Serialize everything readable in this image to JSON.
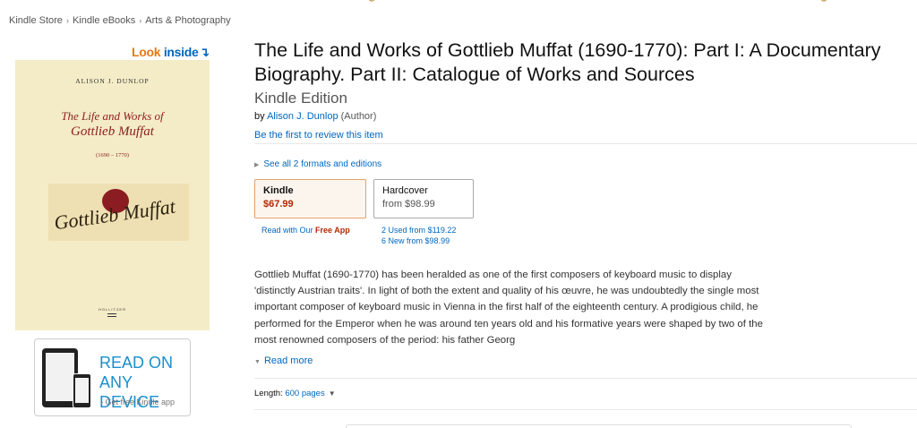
{
  "breadcrumb": [
    "Kindle Store",
    "Kindle eBooks",
    "Arts & Photography"
  ],
  "look_inside": {
    "word1": "Look",
    "word2": "inside",
    "arrow": "↴"
  },
  "cover": {
    "author": "ALISON J. DUNLOP",
    "title_line1": "The Life and Works of",
    "title_line2": "Gottlieb Muffat",
    "dates": "(1690 – 1770)",
    "signature": "Gottlieb Muffat",
    "publisher": "HOLLITZER"
  },
  "read_device": {
    "line1": "READ ON",
    "line2": "ANY DEVICE",
    "sub": "› Get free Kindle app"
  },
  "product": {
    "title": "The Life and Works of Gottlieb Muffat (1690-1770): Part I: A Documentary Biography. Part II: Catalogue of Works and Sources",
    "edition": "Kindle Edition",
    "by": "by",
    "author": "Alison J. Dunlop",
    "role": "(Author)",
    "review_link": "Be the first to review this item",
    "formats_link": "See all 2 formats and editions"
  },
  "formats": {
    "kindle": {
      "name": "Kindle",
      "price": "$67.99"
    },
    "hardcover": {
      "name": "Hardcover",
      "price": "from $98.99"
    }
  },
  "free_app": {
    "prefix": "Read with Our",
    "strong": "Free App"
  },
  "offers": {
    "used_label": "2 Used",
    "used_from": "from",
    "used_price": "$119.22",
    "new_label": "6 New",
    "new_from": "from",
    "new_price": "$98.99"
  },
  "description": "Gottlieb Muffat (1690-1770) has been heralded as one of the first composers of keyboard music to display 'distinctly Austrian traits'. In light of both the extent and quality of his œuvre, he was undoubtedly the single most important composer of keyboard music in Vienna in the first half of the eighteenth century. A prodigious child, he performed for the Emperor when he was around ten years old and his formative years were shaped by two of the most renowned composers of the period: his father Georg",
  "read_more": "Read more",
  "length": {
    "label": "Length:",
    "value": "600 pages"
  },
  "colors": {
    "link": "#0066c0",
    "price": "#b12704",
    "look_inside_orange": "#e47911",
    "kindle_border": "#e3a26c"
  }
}
